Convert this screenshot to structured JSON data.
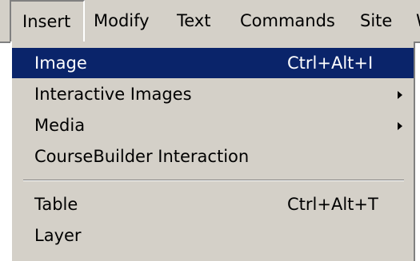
{
  "menubar": {
    "items": [
      {
        "label": "Insert"
      },
      {
        "label": "Modify"
      },
      {
        "label": "Text"
      },
      {
        "label": "Commands"
      },
      {
        "label": "Site"
      },
      {
        "label": "W"
      }
    ]
  },
  "insert_menu": {
    "items": [
      {
        "label": "Image",
        "shortcut": "Ctrl+Alt+I"
      },
      {
        "label": "Interactive Images"
      },
      {
        "label": "Media"
      },
      {
        "label": "CourseBuilder Interaction"
      },
      {
        "label": "Table",
        "shortcut": "Ctrl+Alt+T"
      },
      {
        "label": "Layer"
      }
    ]
  },
  "colors": {
    "menu_background": "#d4d0c8",
    "highlight": "#0a246a",
    "highlight_text": "#ffffff"
  },
  "icons": [
    "submenu-arrow-icon"
  ]
}
